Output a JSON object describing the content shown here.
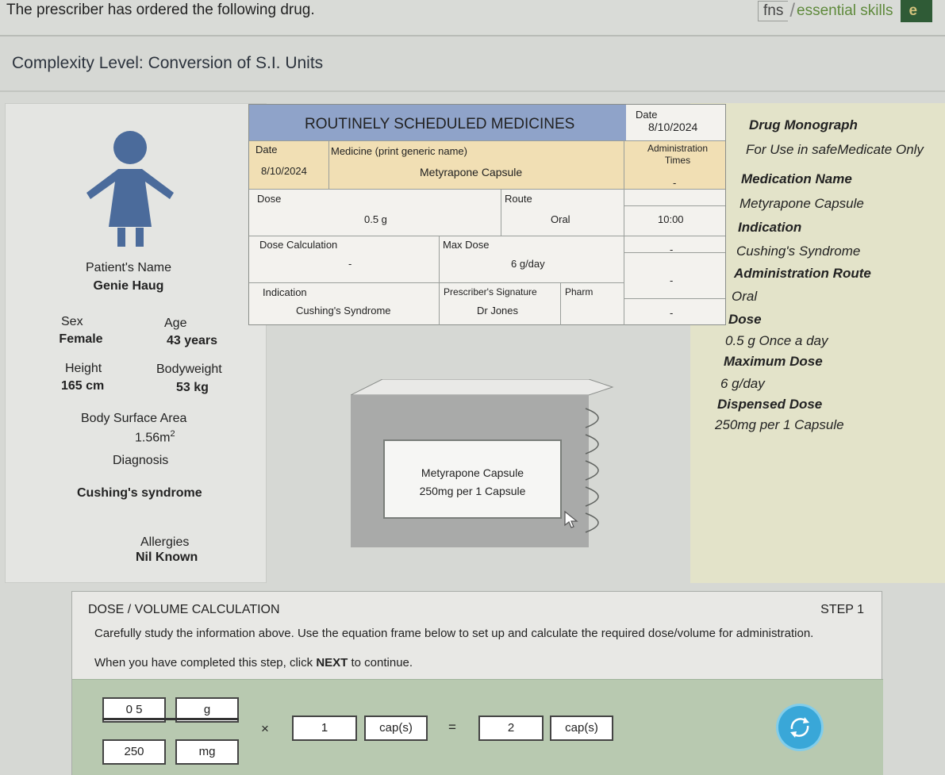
{
  "header": {
    "prompt": "The prescriber has ordered the following drug.",
    "logo_fns": "fns",
    "logo_essential": "essential skills",
    "logo_edge": "e"
  },
  "complexity": "Complexity Level: Conversion of S.I. Units",
  "patient": {
    "name_label": "Patient's Name",
    "name": "Genie Haug",
    "sex_label": "Sex",
    "sex": "Female",
    "age_label": "Age",
    "age": "43 years",
    "height_label": "Height",
    "height": "165 cm",
    "weight_label": "Bodyweight",
    "weight": "53 kg",
    "bsa_label": "Body Surface Area",
    "bsa_value": "1.56m",
    "bsa_sup": "2",
    "diagnosis_label": "Diagnosis",
    "diagnosis": "Cushing's syndrome",
    "allergies_label": "Allergies",
    "allergies": "Nil Known"
  },
  "chart": {
    "title": "ROUTINELY SCHEDULED MEDICINES",
    "date_label": "Date",
    "date_value": "8/10/2024",
    "row_date_label": "Date",
    "row_date": "8/10/2024",
    "medicine_label": "Medicine (print generic name)",
    "medicine": "Metyrapone Capsule",
    "admin_times_label": "Administration Times",
    "dose_label": "Dose",
    "dose": "0.5 g",
    "route_label": "Route",
    "route": "Oral",
    "time_1": "-",
    "time_2": "10:00",
    "time_3": "-",
    "time_4": "-",
    "time_5": "-",
    "dose_calc_label": "Dose Calculation",
    "dose_calc": "-",
    "max_dose_label": "Max Dose",
    "max_dose": "6 g/day",
    "indication_label": "Indication",
    "indication": "Cushing's Syndrome",
    "signature_label": "Prescriber's Signature",
    "signature": "Dr Jones",
    "pharm_label": "Pharm"
  },
  "monograph": {
    "title": "Drug Monograph",
    "subtitle": "For Use in safeMedicate Only",
    "med_name_label": "Medication Name",
    "med_name": "Metyrapone Capsule",
    "indication_label": "Indication",
    "indication": "Cushing's Syndrome",
    "route_label": "Administration Route",
    "route": "Oral",
    "dose_label": "Dose",
    "dose": "0.5 g Once a day",
    "max_label": "Maximum Dose",
    "max": "6 g/day",
    "dispensed_label": "Dispensed Dose",
    "dispensed": "250mg per 1 Capsule"
  },
  "pack": {
    "name": "Metyrapone Capsule",
    "strength": "250mg per 1 Capsule"
  },
  "calc": {
    "heading": "DOSE / VOLUME CALCULATION",
    "step": "STEP 1",
    "instruction": "Carefully study the information above. Use the equation frame below to set up and calculate the required dose/volume for administration.",
    "instruction2_pre": "When you have completed this step, click ",
    "instruction2_bold": "NEXT",
    "instruction2_post": " to continue.",
    "numerator_value": "0 5",
    "numerator_unit": "g",
    "denominator_value": "250",
    "denominator_unit": "mg",
    "times": "×",
    "multiplier_value": "1",
    "multiplier_unit": "cap(s)",
    "equals": "=",
    "result_value": "2",
    "result_unit": "cap(s)"
  },
  "colors": {
    "chart_header": "#8fa3c9",
    "chart_sub": "#f1dfb4",
    "monograph_bg": "#e3e3c9",
    "pack_body": "#a9aaa9",
    "equation_bg": "#b8c9b0",
    "refresh": "#39a7d8"
  },
  "icons": {
    "patient": "person-figure-icon",
    "cursor": "mouse-pointer-icon",
    "refresh": "refresh-icon"
  }
}
